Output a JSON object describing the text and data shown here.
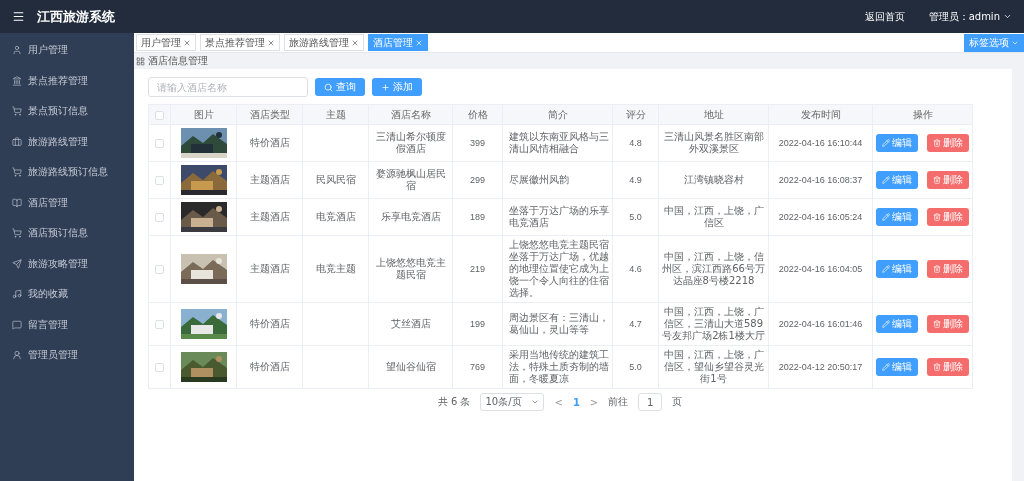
{
  "header": {
    "title": "江西旅游系统",
    "home_link": "返回首页",
    "user": "管理员：admin"
  },
  "sidebar": {
    "items": [
      {
        "label": "用户管理"
      },
      {
        "label": "景点推荐管理"
      },
      {
        "label": "景点预订信息"
      },
      {
        "label": "旅游路线管理"
      },
      {
        "label": "旅游路线预订信息"
      },
      {
        "label": "酒店管理"
      },
      {
        "label": "酒店预订信息"
      },
      {
        "label": "旅游攻略管理"
      },
      {
        "label": "我的收藏"
      },
      {
        "label": "留言管理"
      },
      {
        "label": "管理员管理"
      }
    ]
  },
  "tabs": [
    {
      "label": "用户管理",
      "selected": false
    },
    {
      "label": "景点推荐管理",
      "selected": false
    },
    {
      "label": "旅游路线管理",
      "selected": false
    },
    {
      "label": "酒店管理",
      "selected": true
    }
  ],
  "tab_options": "标签选项",
  "breadcrumb": "酒店信息管理",
  "search": {
    "placeholder": "请输入酒店名称",
    "search_button": "查询",
    "add_button": "添加"
  },
  "table": {
    "all_checked": false,
    "columns": [
      "图片",
      "酒店类型",
      "主题",
      "酒店名称",
      "价格",
      "简介",
      "评分",
      "地址",
      "发布时间",
      "操作"
    ],
    "rows": [
      {
        "checked": false,
        "type": "特价酒店",
        "name": "三清山希尔顿度假酒店",
        "price": "399",
        "intro": "建筑以东南亚风格与三清山风情相融合",
        "score": "4.8",
        "address": "三清山风景名胜区南部外双溪景区",
        "time": "2022-04-16 16:10:44",
        "edit": "编辑",
        "delete": "删除"
      },
      {
        "checked": false,
        "type": "主题酒店",
        "theme": "民风民宿",
        "name": "婺源驰枫山居民宿",
        "price": "299",
        "intro": "尽展徽州风韵",
        "score": "4.9",
        "address": "江湾镇晓容村",
        "time": "2022-04-16 16:08:37",
        "edit": "编辑",
        "delete": "删除"
      },
      {
        "checked": false,
        "type": "主题酒店",
        "theme": "电竞酒店",
        "name": "乐享电竞酒店",
        "price": "189",
        "intro": "坐落于万达广场的乐享电竞酒店",
        "score": "5.0",
        "address": "中国，江西，上饶，广信区",
        "time": "2022-04-16 16:05:24",
        "edit": "编辑",
        "delete": "删除"
      },
      {
        "checked": false,
        "type": "主题酒店",
        "theme": "电竞主题",
        "name": "上饶悠悠电竞主题民宿",
        "price": "219",
        "intro": "上饶悠悠电竞主题民宿坐落于万达广场，优越的地理位置使它成为上饶一个令人向往的住宿选择。",
        "score": "4.6",
        "address": "中国，江西，上饶，信州区，滨江西路66号万达晶座8号楼2218",
        "time": "2022-04-16 16:04:05",
        "edit": "编辑",
        "delete": "删除"
      },
      {
        "checked": false,
        "type": "特价酒店",
        "name": "艾丝酒店",
        "price": "199",
        "intro": "周边景区有：三清山，葛仙山，灵山等等",
        "score": "4.7",
        "address": "中国，江西，上饶，广信区，三清山大道589号友邦广场2栋1楼大厅",
        "time": "2022-04-16 16:01:46",
        "edit": "编辑",
        "delete": "删除"
      },
      {
        "checked": false,
        "type": "特价酒店",
        "name": "望仙谷仙宿",
        "price": "769",
        "intro": "采用当地传统的建筑工法，特殊土质夯制的墙面，冬暖夏凉",
        "score": "5.0",
        "address": "中国，江西，上饶，广信区，望仙乡望谷灵光街1号",
        "time": "2022-04-12 20:50:17",
        "edit": "编辑",
        "delete": "删除"
      }
    ]
  },
  "pagination": {
    "total": "共 6 条",
    "page_size": "10条/页",
    "prev": "<",
    "pages": [
      {
        "label": "1",
        "selected": true
      }
    ],
    "next": ">",
    "goto_label": "前往",
    "goto_value": "1",
    "goto_suffix": "页"
  }
}
